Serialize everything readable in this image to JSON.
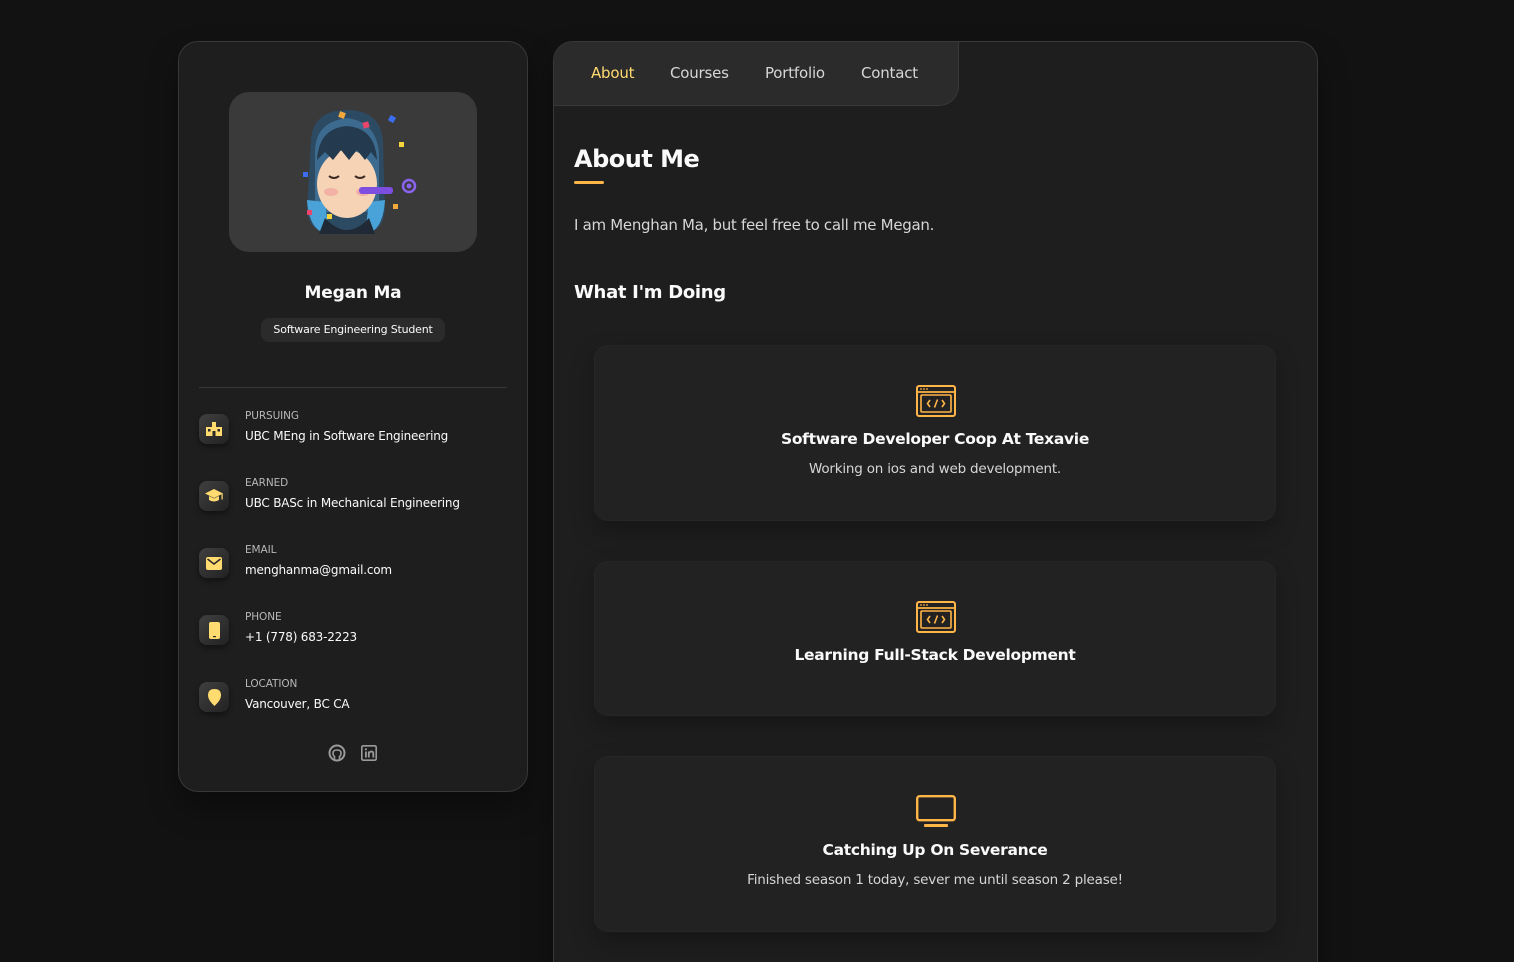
{
  "colors": {
    "accent": "#ffdb70",
    "accent_dark": "#ffb547",
    "bg": "#121212",
    "panel": "#1e1e1f"
  },
  "sidebar": {
    "avatar_icon": "memoji-avatar",
    "name": "Megan Ma",
    "title": "Software Engineering Student",
    "contacts": [
      {
        "icon": "school-icon",
        "label": "PURSUING",
        "value": "UBC MEng in Software Engineering"
      },
      {
        "icon": "graduation-cap-icon",
        "label": "EARNED",
        "value": "UBC BASc in Mechanical Engineering"
      },
      {
        "icon": "mail-icon",
        "label": "EMAIL",
        "value": "menghanma@gmail.com"
      },
      {
        "icon": "phone-icon",
        "label": "PHONE",
        "value": "+1 (778) 683-2223"
      },
      {
        "icon": "location-pin-icon",
        "label": "LOCATION",
        "value": "Vancouver, BC CA"
      }
    ],
    "socials": [
      "github-icon",
      "linkedin-icon"
    ]
  },
  "navbar": {
    "links": [
      "About",
      "Courses",
      "Portfolio",
      "Contact"
    ],
    "active": "About"
  },
  "main": {
    "title": "About Me",
    "about_text": "I am Menghan Ma, but feel free to call me Megan.",
    "section_title": "What I'm Doing",
    "services": [
      {
        "icon": "code-window-icon",
        "title": "Software Developer Coop At Texavie",
        "text": "Working on ios and web development."
      },
      {
        "icon": "code-window-icon",
        "title": "Learning Full-Stack Development",
        "text": ""
      },
      {
        "icon": "monitor-icon",
        "title": "Catching Up On Severance",
        "text": "Finished season 1 today, sever me until season 2 please!"
      }
    ]
  }
}
